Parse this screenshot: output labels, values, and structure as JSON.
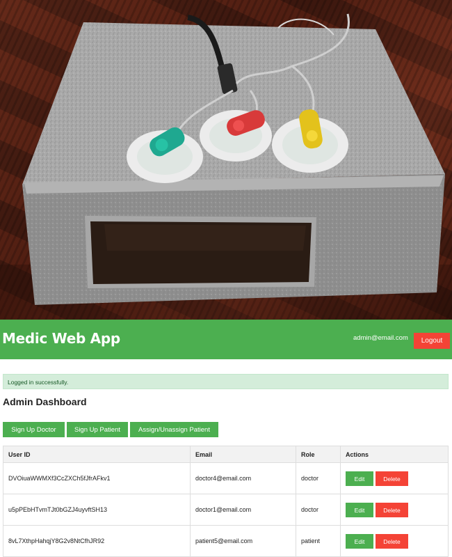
{
  "photo": {
    "description_icon": "ecg-device-photo-icon",
    "electrode_colors": [
      "#1fa890",
      "#d83a3a",
      "#e3c21c"
    ]
  },
  "header": {
    "brand": "Medic Web App",
    "user_email": "admin@email.com",
    "logout_label": "Logout",
    "bg_color": "#4caf50",
    "logout_color": "#f44336"
  },
  "alert": {
    "message": "Logged in successfully."
  },
  "main": {
    "title": "Admin Dashboard",
    "buttons": {
      "signup_doctor": "Sign Up Doctor",
      "signup_patient": "Sign Up Patient",
      "assign_patient": "Assign/Unassign Patient"
    }
  },
  "table": {
    "headers": [
      "User ID",
      "Email",
      "Role",
      "Actions"
    ],
    "rows": [
      {
        "user_id": "DVOiuaWWMXf3CcZXCh5fJfrAFkv1",
        "email": "doctor4@email.com",
        "role": "doctor",
        "edit": "Edit",
        "delete": "Delete"
      },
      {
        "user_id": "u5pPEbHTvmTJt0bGZJ4uyvftSH13",
        "email": "doctor1@email.com",
        "role": "doctor",
        "edit": "Edit",
        "delete": "Delete"
      },
      {
        "user_id": "8vL7XthpHahqjY8G2v8NtCfhJR92",
        "email": "patient5@email.com",
        "role": "patient",
        "edit": "Edit",
        "delete": "Delete"
      }
    ]
  }
}
